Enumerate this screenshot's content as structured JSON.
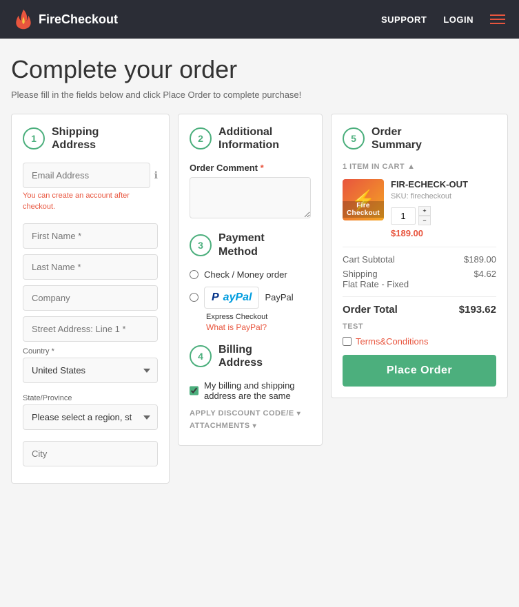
{
  "header": {
    "logo_text": "FireCheckout",
    "nav": {
      "support": "SUPPORT",
      "login": "LOGIN"
    }
  },
  "page": {
    "title": "Complete your order",
    "subtitle": "Please fill in the fields below and click Place Order to complete purchase!"
  },
  "shipping": {
    "step": "1",
    "title_line1": "Shipping",
    "title_line2": "Address",
    "email_placeholder": "Email Address",
    "account_hint": "You can create an account after checkout.",
    "first_name_placeholder": "First Name *",
    "last_name_placeholder": "Last Name *",
    "company_placeholder": "Company",
    "street_placeholder": "Street Address: Line 1 *",
    "country_label": "Country *",
    "country_value": "United States",
    "state_label": "State/Province",
    "state_placeholder": "Please select a region, st",
    "city_placeholder": "City"
  },
  "additional": {
    "step": "2",
    "title": "Additional Information",
    "order_comment_label": "Order Comment",
    "required_marker": "*"
  },
  "payment": {
    "step": "3",
    "title_line1": "Payment",
    "title_line2": "Method",
    "options": [
      {
        "id": "check",
        "label": "Check / Money order"
      },
      {
        "id": "paypal",
        "label": "PayPal"
      }
    ],
    "express_checkout": "Express Checkout",
    "what_is_paypal": "What is PayPal?"
  },
  "billing": {
    "step": "4",
    "title_line1": "Billing",
    "title_line2": "Address",
    "same_address_label": "My billing and shipping address are the same",
    "discount_label": "APPLY DISCOUNT CODE/E",
    "attachments_label": "ATTACHMENTS"
  },
  "order_summary": {
    "step": "5",
    "title_line1": "Order",
    "title_line2": "Summary",
    "cart_count": "1 ITEM IN CART",
    "product": {
      "name": "FIR-ECHECK-OUT",
      "sku_label": "SKU:",
      "sku": "firecheckout",
      "image_label": "Fire Checkout",
      "qty": "1",
      "price": "$189.00"
    },
    "cart_subtotal_label": "Cart Subtotal",
    "cart_subtotal": "$189.00",
    "shipping_label": "Shipping",
    "shipping_sub_label": "Flat Rate - Fixed",
    "shipping_price": "$4.62",
    "order_total_label": "Order Total",
    "order_total": "$193.62",
    "test_label": "TEST",
    "terms_label": "Terms&Conditions",
    "place_order_label": "Place Order"
  }
}
